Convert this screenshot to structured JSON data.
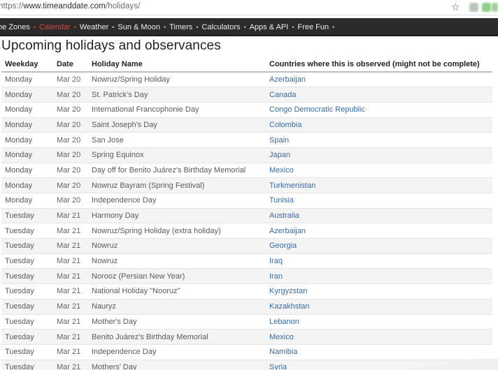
{
  "browser": {
    "url_prefix": "https://",
    "url_host": "www.timeanddate.com",
    "url_path": "/holidays/",
    "star_icon": "bookmark-star-icon"
  },
  "nav": {
    "items": [
      {
        "label": "me Zones",
        "active": false
      },
      {
        "label": "Calendar",
        "active": true
      },
      {
        "label": "Weather",
        "active": false
      },
      {
        "label": "Sun & Moon",
        "active": false
      },
      {
        "label": "Timers",
        "active": false
      },
      {
        "label": "Calculators",
        "active": false
      },
      {
        "label": "Apps & API",
        "active": false
      },
      {
        "label": "Free Fun",
        "active": false
      }
    ],
    "separator": "•",
    "accent_color": "#e8413a"
  },
  "page": {
    "title": "Upcoming holidays and observances"
  },
  "table": {
    "headers": [
      "Weekday",
      "Date",
      "Holiday Name",
      "Countries where this is observed (might not be complete)"
    ],
    "rows": [
      [
        "Monday",
        "Mar 20",
        "Nowruz/Spring Holiday",
        "Azerbaijan"
      ],
      [
        "Monday",
        "Mar 20",
        "St. Patrick's Day",
        "Canada"
      ],
      [
        "Monday",
        "Mar 20",
        "International Francophonie Day",
        "Congo Democratic Republic"
      ],
      [
        "Monday",
        "Mar 20",
        "Saint Joseph's Day",
        "Colombia"
      ],
      [
        "Monday",
        "Mar 20",
        "San Jose",
        "Spain"
      ],
      [
        "Monday",
        "Mar 20",
        "Spring Equinox",
        "Japan"
      ],
      [
        "Monday",
        "Mar 20",
        "Day off for Benito Juárez's Birthday Memorial",
        "Mexico"
      ],
      [
        "Monday",
        "Mar 20",
        "Nowruz Bayram (Spring Festival)",
        "Turkmenistan"
      ],
      [
        "Monday",
        "Mar 20",
        "Independence Day",
        "Tunisia"
      ],
      [
        "Tuesday",
        "Mar 21",
        "Harmony Day",
        "Australia"
      ],
      [
        "Tuesday",
        "Mar 21",
        "Nowruz/Spring Holiday (extra holiday)",
        "Azerbaijan"
      ],
      [
        "Tuesday",
        "Mar 21",
        "Nowruz",
        "Georgia"
      ],
      [
        "Tuesday",
        "Mar 21",
        "Nowruz",
        "Iraq"
      ],
      [
        "Tuesday",
        "Mar 21",
        "Norooz (Persian New Year)",
        "Iran"
      ],
      [
        "Tuesday",
        "Mar 21",
        "National Holiday \"Nooruz\"",
        "Kyrgyzstan"
      ],
      [
        "Tuesday",
        "Mar 21",
        "Nauryz",
        "Kazakhstan"
      ],
      [
        "Tuesday",
        "Mar 21",
        "Mother's Day",
        "Lebanon"
      ],
      [
        "Tuesday",
        "Mar 21",
        "Benito Juárez's Birthday Memorial",
        "Mexico"
      ],
      [
        "Tuesday",
        "Mar 21",
        "Independence Day",
        "Namibia"
      ],
      [
        "Tuesday",
        "Mar 21",
        "Mothers' Day",
        "Syria"
      ]
    ],
    "link_color": "#3a6aa8"
  }
}
